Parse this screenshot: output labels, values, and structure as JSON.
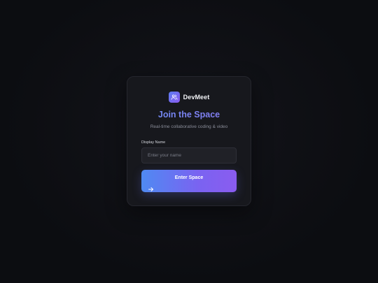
{
  "brand": {
    "name": "DevMeet",
    "logo_icon": "users-icon"
  },
  "join": {
    "title": "Join the Space",
    "subtitle": "Real-time collaborative coding & video"
  },
  "form": {
    "name_label": "Display Name",
    "name_placeholder": "Enter your name",
    "name_value": "",
    "submit_label": "Enter Space",
    "submit_icon": "arrow-right-icon"
  },
  "colors": {
    "background": "#0c0d11",
    "card": "#17181d",
    "accent_start": "#4f8af2",
    "accent_end": "#8a5cf0",
    "title": "#7a8ff5"
  }
}
